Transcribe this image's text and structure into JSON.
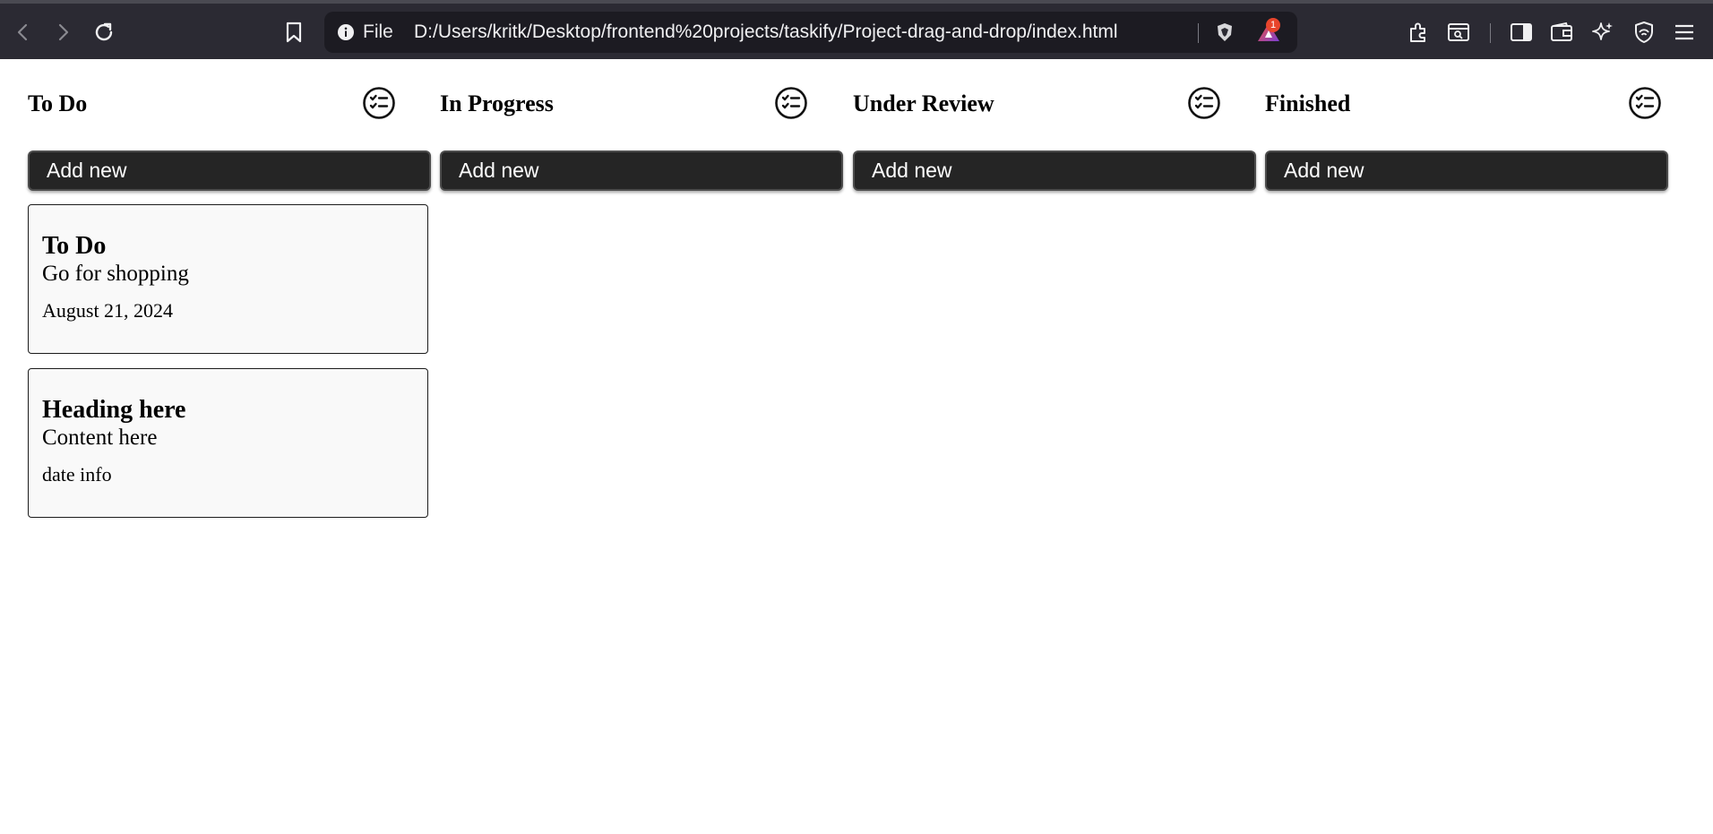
{
  "browser": {
    "url_scheme_label": "File",
    "url": "D:/Users/kritk/Desktop/frontend%20projects/taskify/Project-drag-and-drop/index.html",
    "notification_count": "1"
  },
  "columns": [
    {
      "title": "To Do",
      "add_label": "Add new"
    },
    {
      "title": "In Progress",
      "add_label": "Add new"
    },
    {
      "title": "Under Review",
      "add_label": "Add new"
    },
    {
      "title": "Finished",
      "add_label": "Add new"
    }
  ],
  "cards": [
    {
      "heading": "To Do",
      "content": "Go for shopping",
      "date": "August 21, 2024"
    },
    {
      "heading": "Heading here",
      "content": "Content here",
      "date": "date info"
    }
  ],
  "icons": {
    "column_menu": "checklist-icon"
  }
}
